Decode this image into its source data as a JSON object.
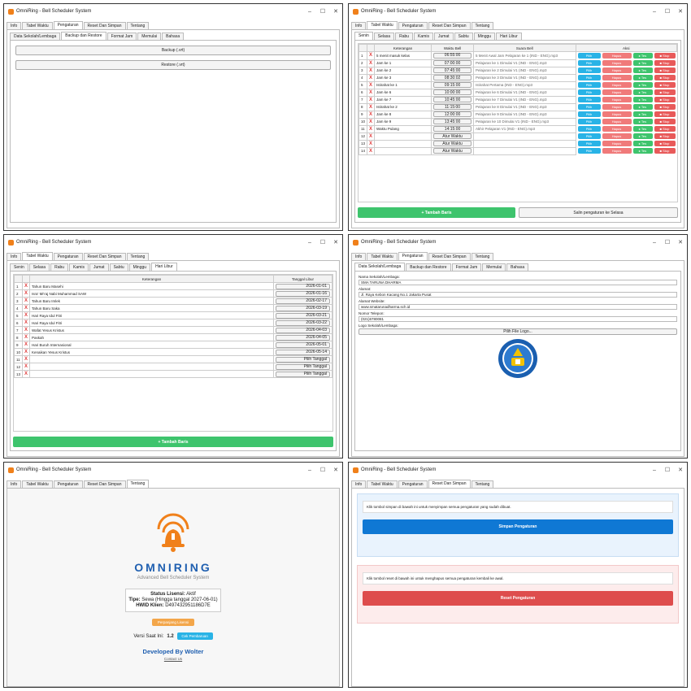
{
  "window": {
    "title": "OmniRing - Bell Scheduler System",
    "minimize": "–",
    "maximize": "☐",
    "close": "✕"
  },
  "main_tabs": [
    "Info",
    "Tabel Waktu",
    "Pengaturan",
    "Reset Dan Simpan",
    "Tentang"
  ],
  "settings_tabs": [
    "Data Sekolah/Lembaga",
    "Backup dan Restore",
    "Format Jam",
    "Memulai",
    "Bahasa"
  ],
  "day_tabs": [
    "Senin",
    "Selasa",
    "Rabu",
    "Kamis",
    "Jumat",
    "Sabtu",
    "Minggu",
    "Hari Libur"
  ],
  "backup": {
    "backup_label": "Backup (.vrt)",
    "restore_label": "Restore (.vrt)"
  },
  "schedule": {
    "headers": [
      "Keterangan",
      "Waktu Bell",
      "Suara Bell",
      "Aksi"
    ],
    "rows": [
      {
        "no": "1",
        "ket": "5 menit masuk kelas",
        "time": "06:55:00",
        "sound": "5 Menit Awal Jam Pelajaran ke 1 (IND - ENG).mp3"
      },
      {
        "no": "2",
        "ket": "Jam ke 1",
        "time": "07:00:00",
        "sound": "Pelajaran ke 1 Dimulai V1 (IND - ENG).mp3"
      },
      {
        "no": "3",
        "ket": "Jam ke 2",
        "time": "07:45:00",
        "sound": "Pelajaran ke 2 Dimulai V1 (IND - ENG).mp3"
      },
      {
        "no": "4",
        "ket": "Jam ke 3",
        "time": "08:30:02",
        "sound": "Pelajaran ke 3 Dimulai V1 (IND - ENG).mp3"
      },
      {
        "no": "5",
        "ket": "Istirahat ke 1",
        "time": "09:15:00",
        "sound": "Istirahat Pertama (IND - ENG).mp3"
      },
      {
        "no": "6",
        "ket": "Jam ke 6",
        "time": "10:00:00",
        "sound": "Pelajaran ke 6 Dimulai V1 (IND - ENG).mp3"
      },
      {
        "no": "7",
        "ket": "Jam ke 7",
        "time": "10:45:00",
        "sound": "Pelajaran ke 7 Dimulai V1 (IND - ENG).mp3"
      },
      {
        "no": "8",
        "ket": "Istirahat ke 2",
        "time": "11:15:00",
        "sound": "Pelajaran ke 8 Dimulai V1 (IND - ENG).mp3"
      },
      {
        "no": "9",
        "ket": "Jam ke 8",
        "time": "12:00:00",
        "sound": "Pelajaran ke 9 Dimulai V1 (IND - ENG).mp3"
      },
      {
        "no": "10",
        "ket": "Jam ke 9",
        "time": "13:45:00",
        "sound": "Pelajaran ke 10 Dimulai V1 (IND - ENG).mp3"
      },
      {
        "no": "11",
        "ket": "Waktu Pulang",
        "time": "14:15:00",
        "sound": "Akhir Pelajaran V1 (IND - ENG).mp3"
      },
      {
        "no": "12",
        "ket": "",
        "time": "Atur Waktu",
        "sound": ""
      },
      {
        "no": "13",
        "ket": "",
        "time": "Atur Waktu",
        "sound": ""
      },
      {
        "no": "14",
        "ket": "",
        "time": "Atur Waktu",
        "sound": ""
      }
    ],
    "pilih": "Pilih",
    "hapus": "Hapus",
    "tes": "▸ Tes",
    "stop": "■ Stop",
    "add_label": "+ Tambah Baris",
    "copy_label": "Salin pengaturan ke Selasa"
  },
  "holidays": {
    "headers": [
      "Keterangan",
      "Tanggal Libur"
    ],
    "rows": [
      {
        "no": "1",
        "ket": "Tahun Baru Masehi",
        "date": "2026-01-01"
      },
      {
        "no": "2",
        "ket": "Isra' Mi'raj Nabi Muhammad SAW",
        "date": "2026-01-16"
      },
      {
        "no": "3",
        "ket": "Tahun Baru Imlek",
        "date": "2026-02-17"
      },
      {
        "no": "4",
        "ket": "Tahun Baru Saka",
        "date": "2026-03-19"
      },
      {
        "no": "5",
        "ket": "Hari Raya Idul Fitri",
        "date": "2026-03-21"
      },
      {
        "no": "6",
        "ket": "Hari Raya Idul Fitri",
        "date": "2026-03-22"
      },
      {
        "no": "7",
        "ket": "Wafat Yesus Kristus",
        "date": "2026-04-03"
      },
      {
        "no": "8",
        "ket": "Paskah",
        "date": "2026-04-05"
      },
      {
        "no": "9",
        "ket": "Hari Buruh Internasional",
        "date": "2026-05-01"
      },
      {
        "no": "10",
        "ket": "Kenaikan Yesus Kristus",
        "date": "2026-05-14"
      },
      {
        "no": "11",
        "ket": "",
        "date": "Pilih Tanggal"
      },
      {
        "no": "12",
        "ket": "",
        "date": "Pilih Tanggal"
      },
      {
        "no": "13",
        "ket": "",
        "date": "Pilih Tanggal"
      }
    ],
    "add_label": "+ Tambah Baris"
  },
  "school": {
    "name_label": "Nama Sekolah/Lembaga:",
    "name_value": "SMA TARUNA DHARMA",
    "addr_label": "Alamat:",
    "addr_value": "Jl. Raya Kebon Kacang No.1 Jakarta Pusat",
    "web_label": "Alamat Website:",
    "web_value": "www.smatarunadharma.sch.id",
    "phone_label": "Nomor Telepon:",
    "phone_value": "(021)6780081",
    "logo_label": "Logo Sekolah/Lembaga:",
    "logo_button": "Pilih File Logo..."
  },
  "about": {
    "brand": "OMNIRING",
    "subtitle": "Advanced Bell Scheduler System",
    "status_label": "Status Lisensi:",
    "status_value": "Aktif",
    "type_label": "Tipe:",
    "type_value": "Sewa (Hingga tanggal 2027-06-01)",
    "hwid_label": "HWID Klien:",
    "hwid_value": "D497432951186D7E",
    "extend_label": "Perpanjang Lisensi",
    "version_label": "Versi Saat Ini:",
    "version_value": "1.2",
    "update_label": "Cek Pembaruan",
    "dev_label": "Developed By Wolter",
    "contact_label": "Contact Us"
  },
  "reset": {
    "save_text": "Klik tombol simpan di bawah ini untuk menyimpan semua pengaturan yang sudah dibuat.",
    "save_button": "Simpan Pengaturan",
    "reset_text": "Klik tombol reset di bawah ini untuk menghapus semua pengaturan kembali ke awal.",
    "reset_button": "Reset Pengaturan"
  },
  "colors": {
    "accent_orange": "#f0801a",
    "blue": "#0f78d4",
    "red": "#de4d4d",
    "green": "#3ec46d",
    "cyan": "#29b3e6"
  }
}
